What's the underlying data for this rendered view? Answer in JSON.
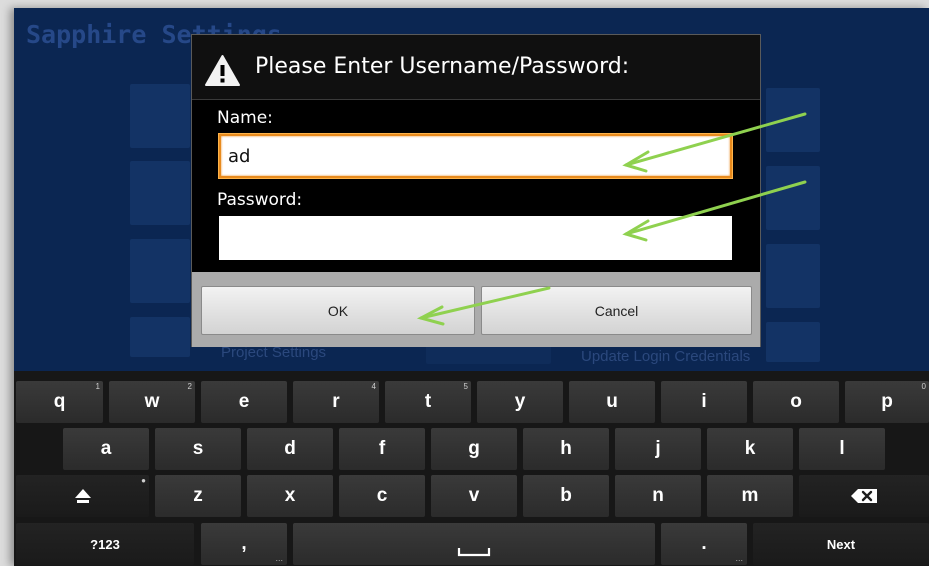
{
  "app": {
    "title": "Sapphire Settings",
    "tile_labels": [
      "Project Settings",
      "Update Login Credentials"
    ]
  },
  "dialog": {
    "title": "Please Enter Username/Password:",
    "name_label": "Name:",
    "name_value": "ad",
    "password_label": "Password:",
    "password_value": "",
    "ok_label": "OK",
    "cancel_label": "Cancel"
  },
  "keyboard": {
    "row1": [
      {
        "key": "q",
        "hint": "1"
      },
      {
        "key": "w",
        "hint": "2"
      },
      {
        "key": "e",
        "hint": ""
      },
      {
        "key": "r",
        "hint": "4"
      },
      {
        "key": "t",
        "hint": "5"
      },
      {
        "key": "y",
        "hint": ""
      },
      {
        "key": "u",
        "hint": ""
      },
      {
        "key": "i",
        "hint": ""
      },
      {
        "key": "o",
        "hint": ""
      },
      {
        "key": "p",
        "hint": "0"
      }
    ],
    "row2": [
      "a",
      "s",
      "d",
      "f",
      "g",
      "h",
      "j",
      "k",
      "l"
    ],
    "row3": [
      "z",
      "x",
      "c",
      "v",
      "b",
      "n",
      "m"
    ],
    "symbols_label": "?123",
    "comma_label": ",",
    "comma_hint": "...",
    "period_label": ".",
    "period_hint": "...",
    "next_label": "Next",
    "shift_icon": "shift-icon",
    "delete_icon": "backspace-icon",
    "space_icon": "spacebar-icon"
  },
  "colors": {
    "accent_focus": "#e88b1e",
    "annotation_arrow": "#8fd14f",
    "background_app": "#0c2a5a"
  }
}
